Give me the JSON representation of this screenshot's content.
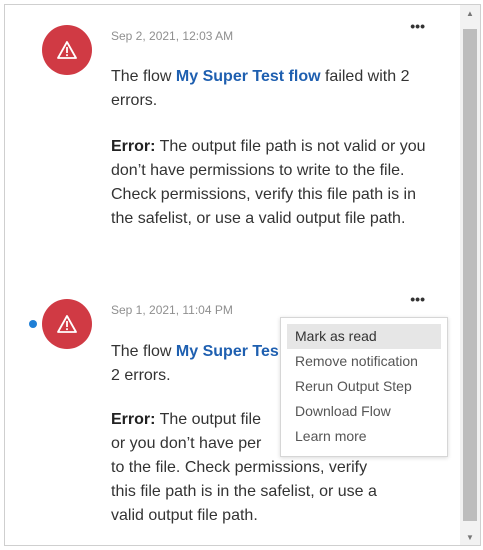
{
  "notifications": [
    {
      "timestamp": "Sep 2, 2021, 12:03 AM",
      "message_prefix": "The flow ",
      "flow_name": "My Super Test flow",
      "message_suffix": " failed with 2 errors.",
      "error_label": "Error:",
      "error_text": " The output file path is not valid or you don’t have permissions to write to the file. Check permissions, verify this file path is in the safelist, or use a valid output file path.",
      "unread": false
    },
    {
      "timestamp": "Sep 1, 2021, 11:04 PM",
      "message_prefix": "The flow ",
      "flow_name": "My Super Tes",
      "message_suffix_line2": "2 errors.",
      "error_label": "Error:",
      "error_line1": " The output file",
      "error_line2": "or you don’t have per",
      "error_line3": "to the file. Check permissions, verify",
      "error_line4": "this file path is in the safelist, or use a",
      "error_line5": "valid output file path.",
      "unread": true
    }
  ],
  "more_glyph": "•••",
  "context_menu": {
    "items": [
      "Mark as read",
      "Remove notification",
      "Rerun Output Step",
      "Download Flow",
      "Learn more"
    ],
    "hovered_index": 0
  },
  "scrollbar": {
    "up": "▲",
    "down": "▼"
  },
  "colors": {
    "alert": "#d03a44",
    "link": "#1e5fb0",
    "unread_dot": "#1f7fd6"
  }
}
